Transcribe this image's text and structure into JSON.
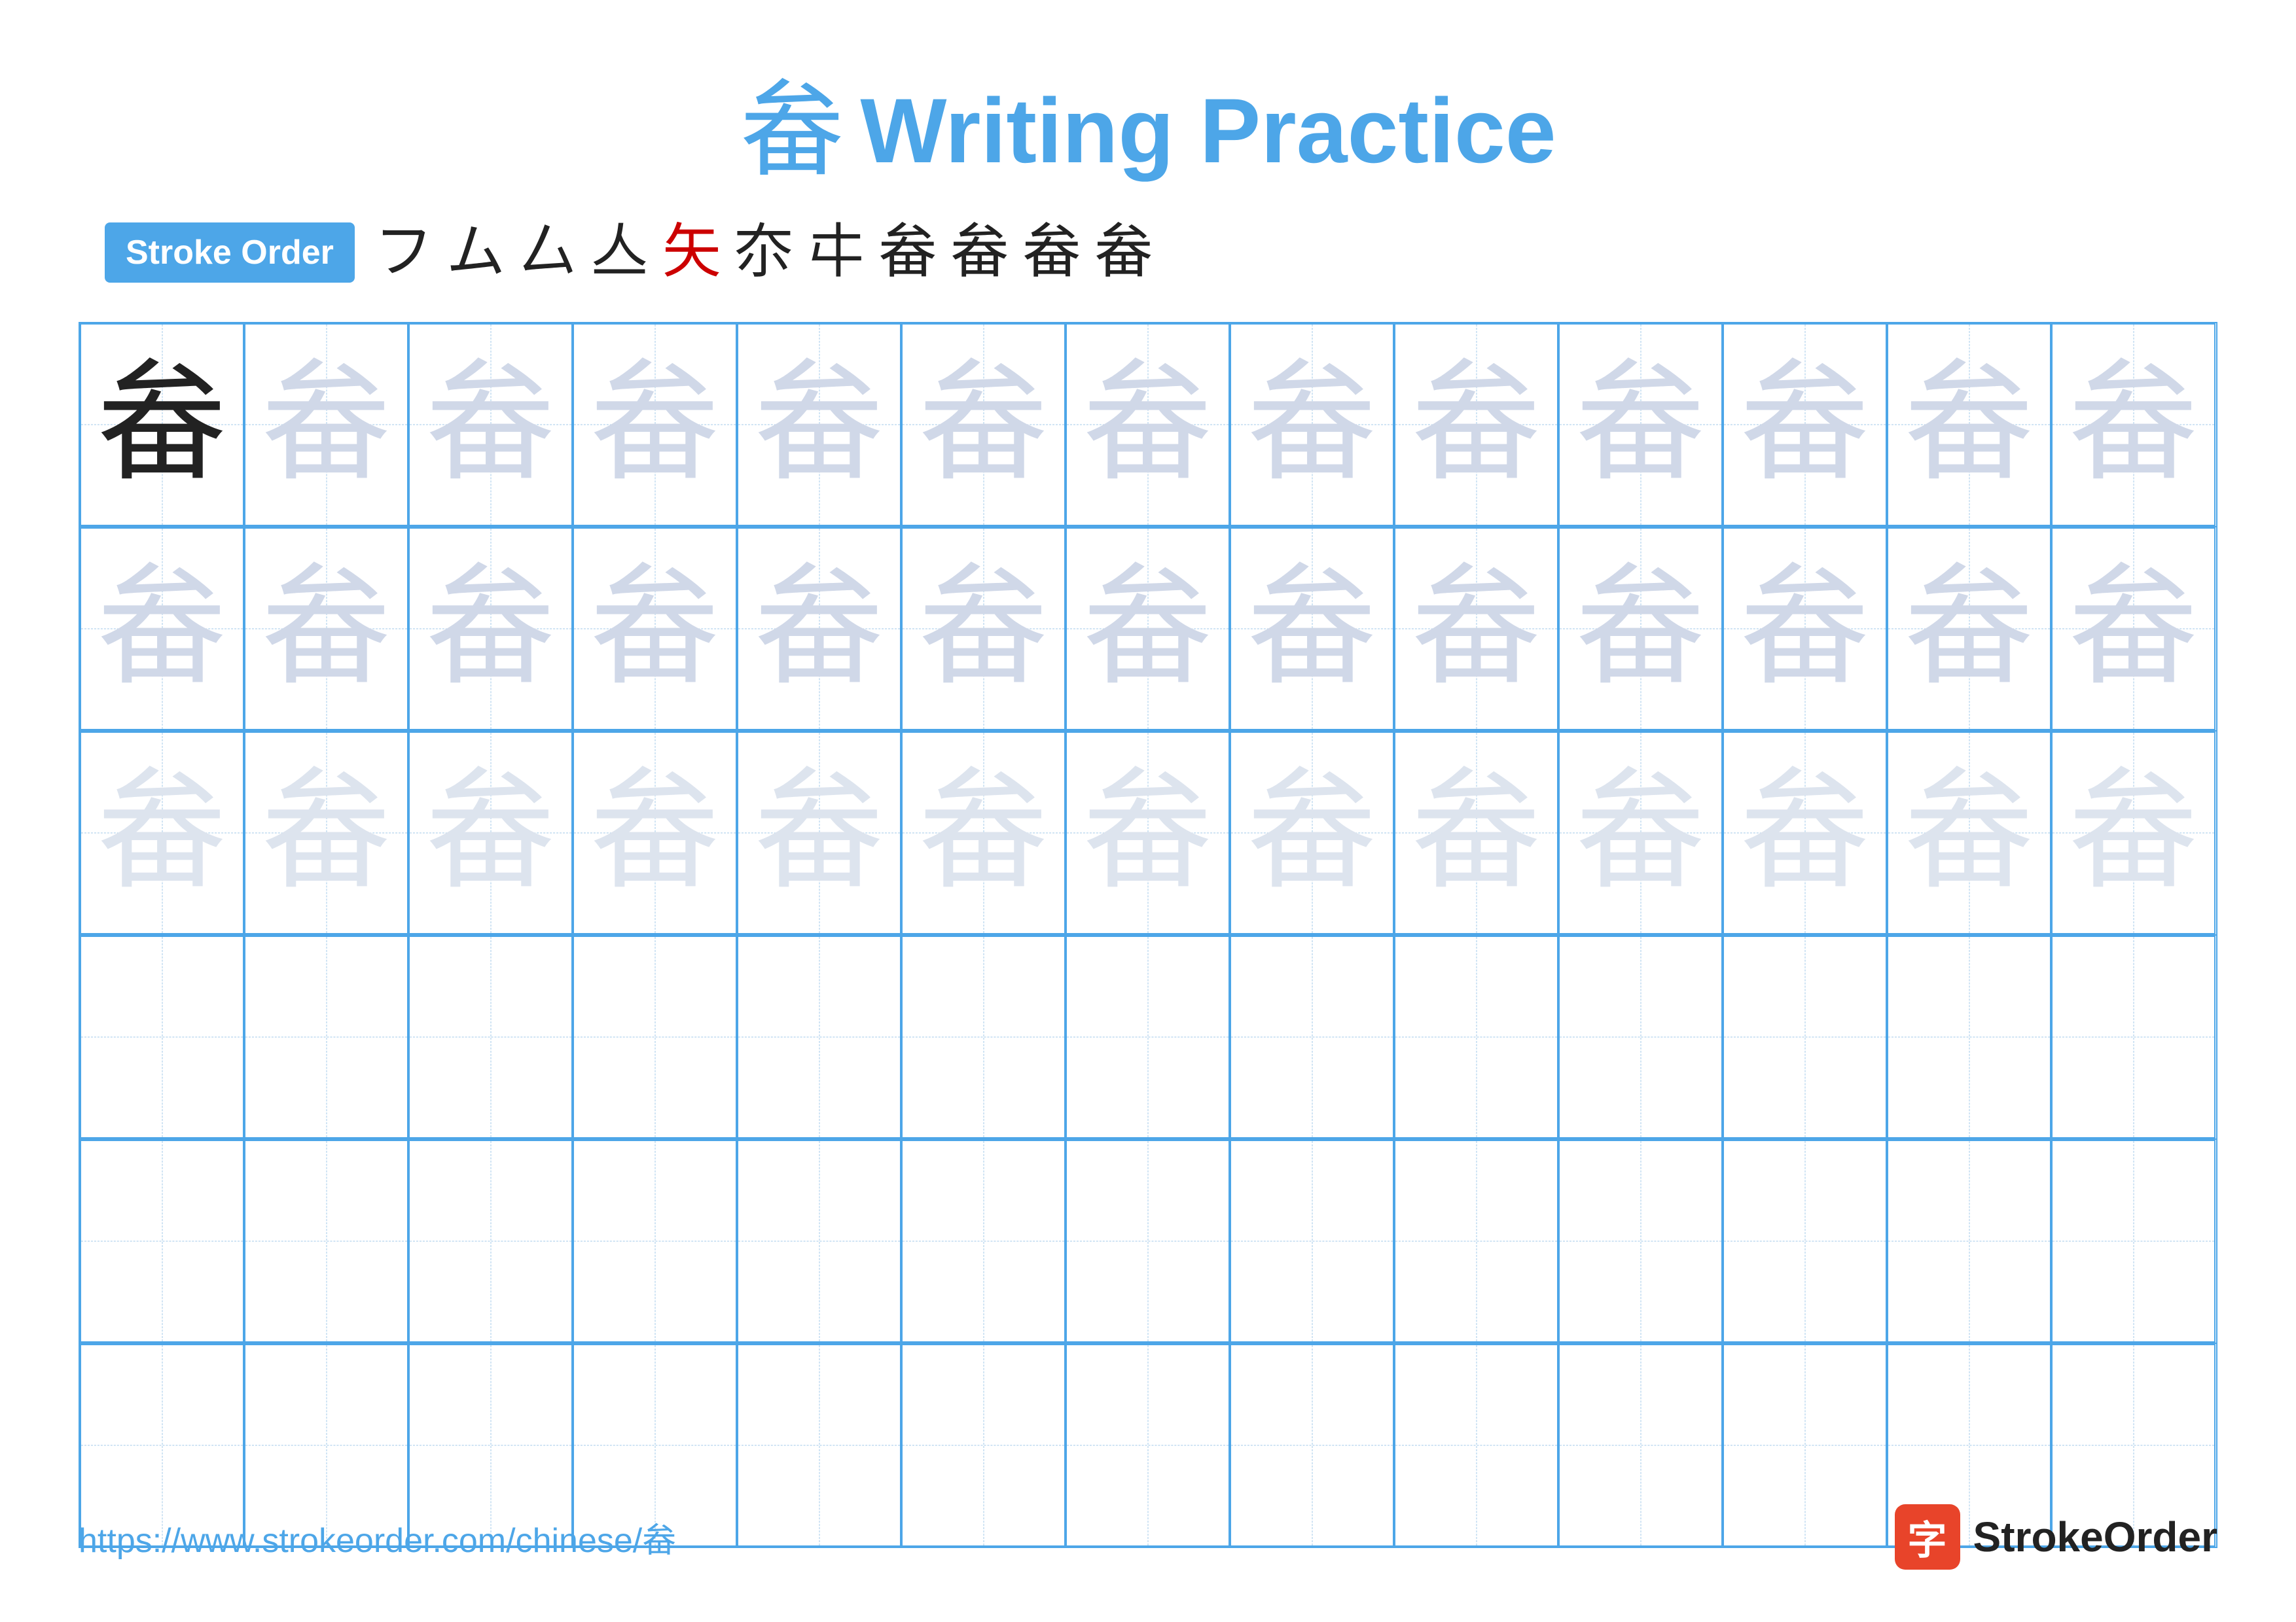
{
  "title": {
    "char": "畚",
    "text": "Writing Practice"
  },
  "stroke_order": {
    "badge_label": "Stroke Order",
    "steps": [
      "乙",
      "ム",
      "厶",
      "𠂆",
      "𠂇",
      "夵",
      "夵",
      "畚",
      "畚",
      "畚",
      "畚"
    ]
  },
  "grid": {
    "rows": 6,
    "cols": 13,
    "char": "畚",
    "filled_rows": 3
  },
  "footer": {
    "url": "https://www.strokeorder.com/chinese/畚",
    "brand_char": "字",
    "brand_name": "StrokeOrder"
  }
}
